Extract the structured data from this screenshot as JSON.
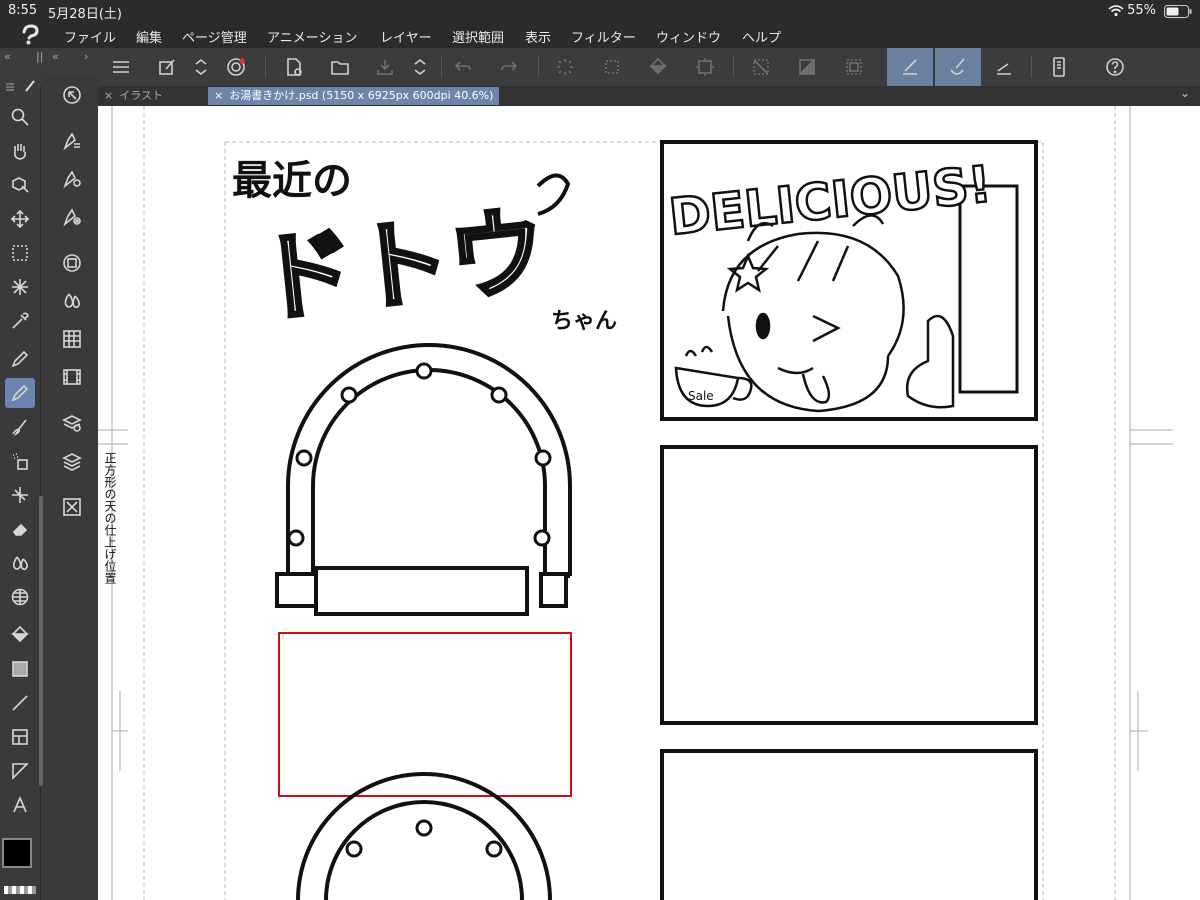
{
  "status": {
    "time": "8:55",
    "date": "5月28日(土)",
    "battery": "55%"
  },
  "menu": [
    "ファイル",
    "編集",
    "ページ管理",
    "アニメーション",
    "レイヤー",
    "選択範囲",
    "表示",
    "フィルター",
    "ウィンドウ",
    "ヘルプ"
  ],
  "tabs": [
    {
      "label": "イラスト"
    },
    {
      "label": "お湯書きかけ.psd (5150 x 6925px 600dpi 40.6%)"
    }
  ],
  "canvas": {
    "guide_label": "正方形の天の仕上げ位置",
    "title_line1": "最近の",
    "title_main": "ドトウ",
    "title_suffix": "ちゃん",
    "panel_text": "DELICIOUS!",
    "cup_text": "Sale"
  },
  "colors": {
    "accent": "#6d84ab",
    "selection_box": "#d01010"
  }
}
